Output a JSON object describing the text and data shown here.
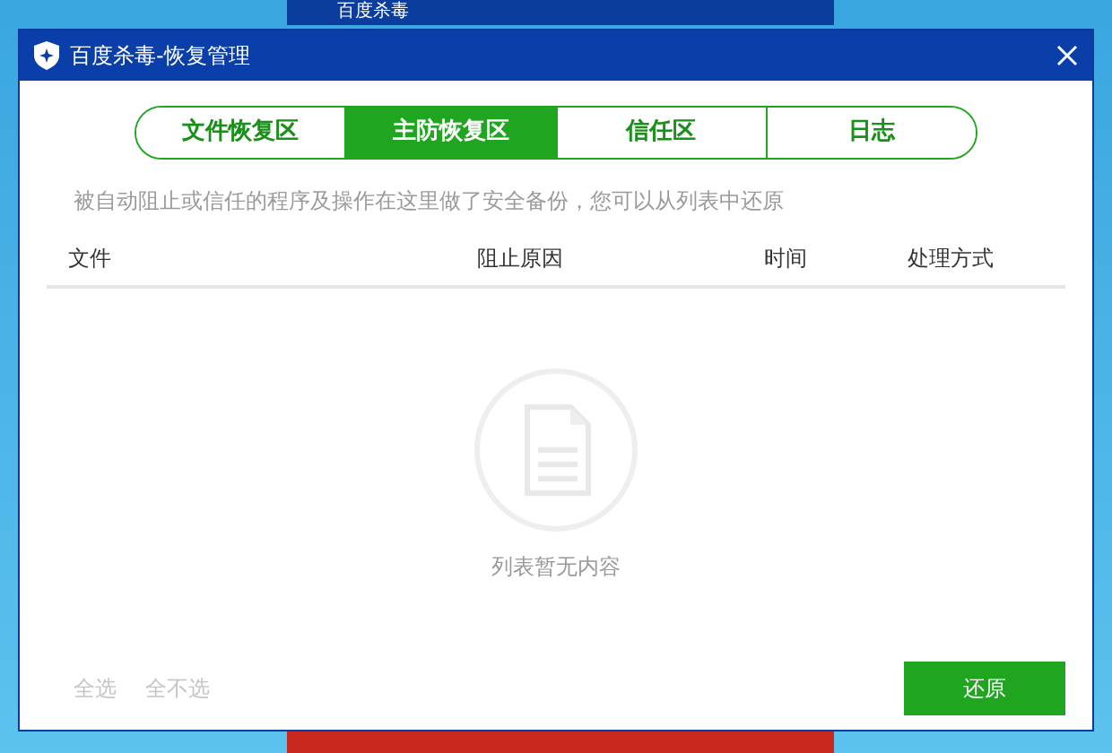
{
  "background_window": {
    "title": "百度杀毒"
  },
  "window": {
    "title": "百度杀毒-恢复管理"
  },
  "tabs": [
    {
      "label": "文件恢复区",
      "selected": false
    },
    {
      "label": "主防恢复区",
      "selected": true
    },
    {
      "label": "信任区",
      "selected": false
    },
    {
      "label": "日志",
      "selected": false
    }
  ],
  "description": "被自动阻止或信任的程序及操作在这里做了安全备份，您可以从列表中还原",
  "table": {
    "columns": [
      "文件",
      "阻止原因",
      "时间",
      "处理方式"
    ],
    "empty_text": "列表暂无内容"
  },
  "footer": {
    "links": [
      {
        "label": "全选",
        "disabled": true
      },
      {
        "label": "全不选",
        "disabled": true
      }
    ],
    "button": {
      "label": "还原"
    }
  }
}
